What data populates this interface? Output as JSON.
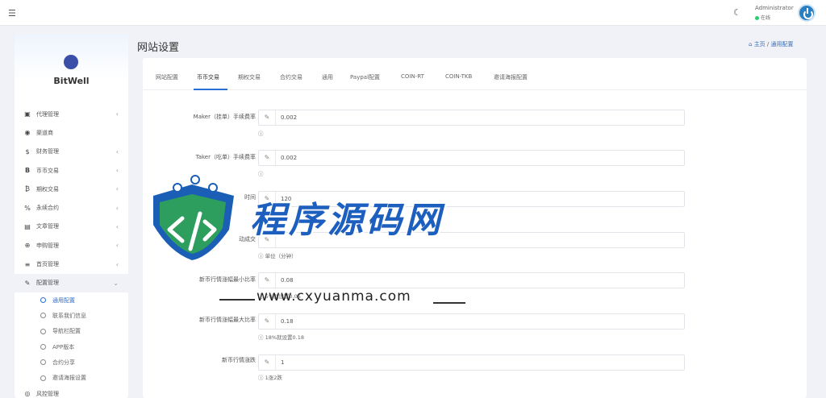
{
  "topbar": {
    "user_name": "Administrator",
    "user_status": "在线"
  },
  "sidebar": {
    "brand": "BitWell",
    "items": [
      {
        "label": "代理管理",
        "icon": "id-card-icon",
        "arrow": "‹"
      },
      {
        "label": "渠道商",
        "icon": "user-circle-icon",
        "arrow": ""
      },
      {
        "label": "财务管理",
        "icon": "dollar-icon",
        "arrow": "‹"
      },
      {
        "label": "币币交易",
        "icon": "bitcoin-icon",
        "arrow": "‹"
      },
      {
        "label": "期权交易",
        "icon": "bitcoin-icon",
        "arrow": "‹"
      },
      {
        "label": "永续合约",
        "icon": "link-icon",
        "arrow": "‹"
      },
      {
        "label": "文章管理",
        "icon": "keyboard-icon",
        "arrow": "‹"
      },
      {
        "label": "申购管理",
        "icon": "lifebuoy-icon",
        "arrow": "‹"
      },
      {
        "label": "首页管理",
        "icon": "bars-icon",
        "arrow": "‹"
      },
      {
        "label": "配置管理",
        "icon": "wrench-icon",
        "arrow": "⌄"
      }
    ],
    "subitems": [
      {
        "label": "通用配置"
      },
      {
        "label": "联系我们信息"
      },
      {
        "label": "导航栏配置"
      },
      {
        "label": "APP版本"
      },
      {
        "label": "合约分享"
      },
      {
        "label": "邀请海报设置"
      }
    ],
    "last_item": {
      "label": "风控管理"
    }
  },
  "header": {
    "title": "网站设置",
    "breadcrumb_home": "主页",
    "breadcrumb_current": "通用配置"
  },
  "tabs": [
    "网站配置",
    "币币交易",
    "期权交易",
    "合约交易",
    "通用",
    "Paypal配置",
    "COIN-RT",
    "COIN-TKB",
    "邀请海报配置"
  ],
  "form": {
    "rows": [
      {
        "label": "Maker（挂单）手续费率",
        "value": "0.002",
        "help": ""
      },
      {
        "label": "Taker（吃单）手续费率",
        "value": "0.002",
        "help": ""
      },
      {
        "label": "时间",
        "value": "120",
        "help": ""
      },
      {
        "label": "动成交",
        "value": "",
        "help": "单位（分钟）"
      },
      {
        "label": "新币行情涨幅最小比率",
        "value": "0.08",
        "help": "5%就设置0.05"
      },
      {
        "label": "新币行情涨幅最大比率",
        "value": "0.18",
        "help": "18%就设置0.18"
      },
      {
        "label": "新币行情涨跌",
        "value": "1",
        "help": "1涨2跌"
      }
    ]
  },
  "watermark": {
    "title": "程序源码网",
    "url": "www.cxyuanma.com"
  }
}
